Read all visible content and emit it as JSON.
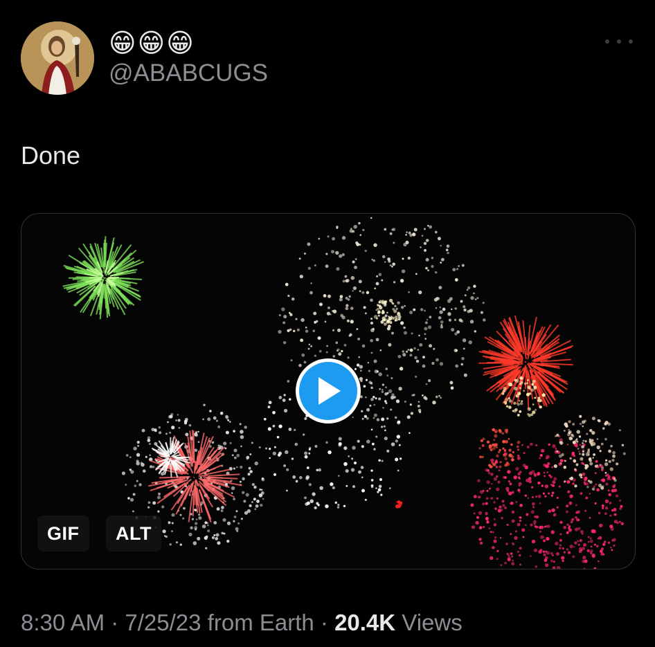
{
  "author": {
    "display_name": "😁😁😁",
    "handle": "@ABABCUGS"
  },
  "tweet": {
    "text": "Done"
  },
  "media": {
    "gif_badge": "GIF",
    "alt_badge": "ALT"
  },
  "meta": {
    "time": "8:30 AM",
    "sep1": " · ",
    "date": "7/25/23",
    "source": " from Earth",
    "sep2": " · ",
    "views_count": "20.4K",
    "views_label": " Views"
  },
  "colors": {
    "accent": "#1d9bf0",
    "background": "#000000",
    "secondary_text": "#8b8f94"
  }
}
